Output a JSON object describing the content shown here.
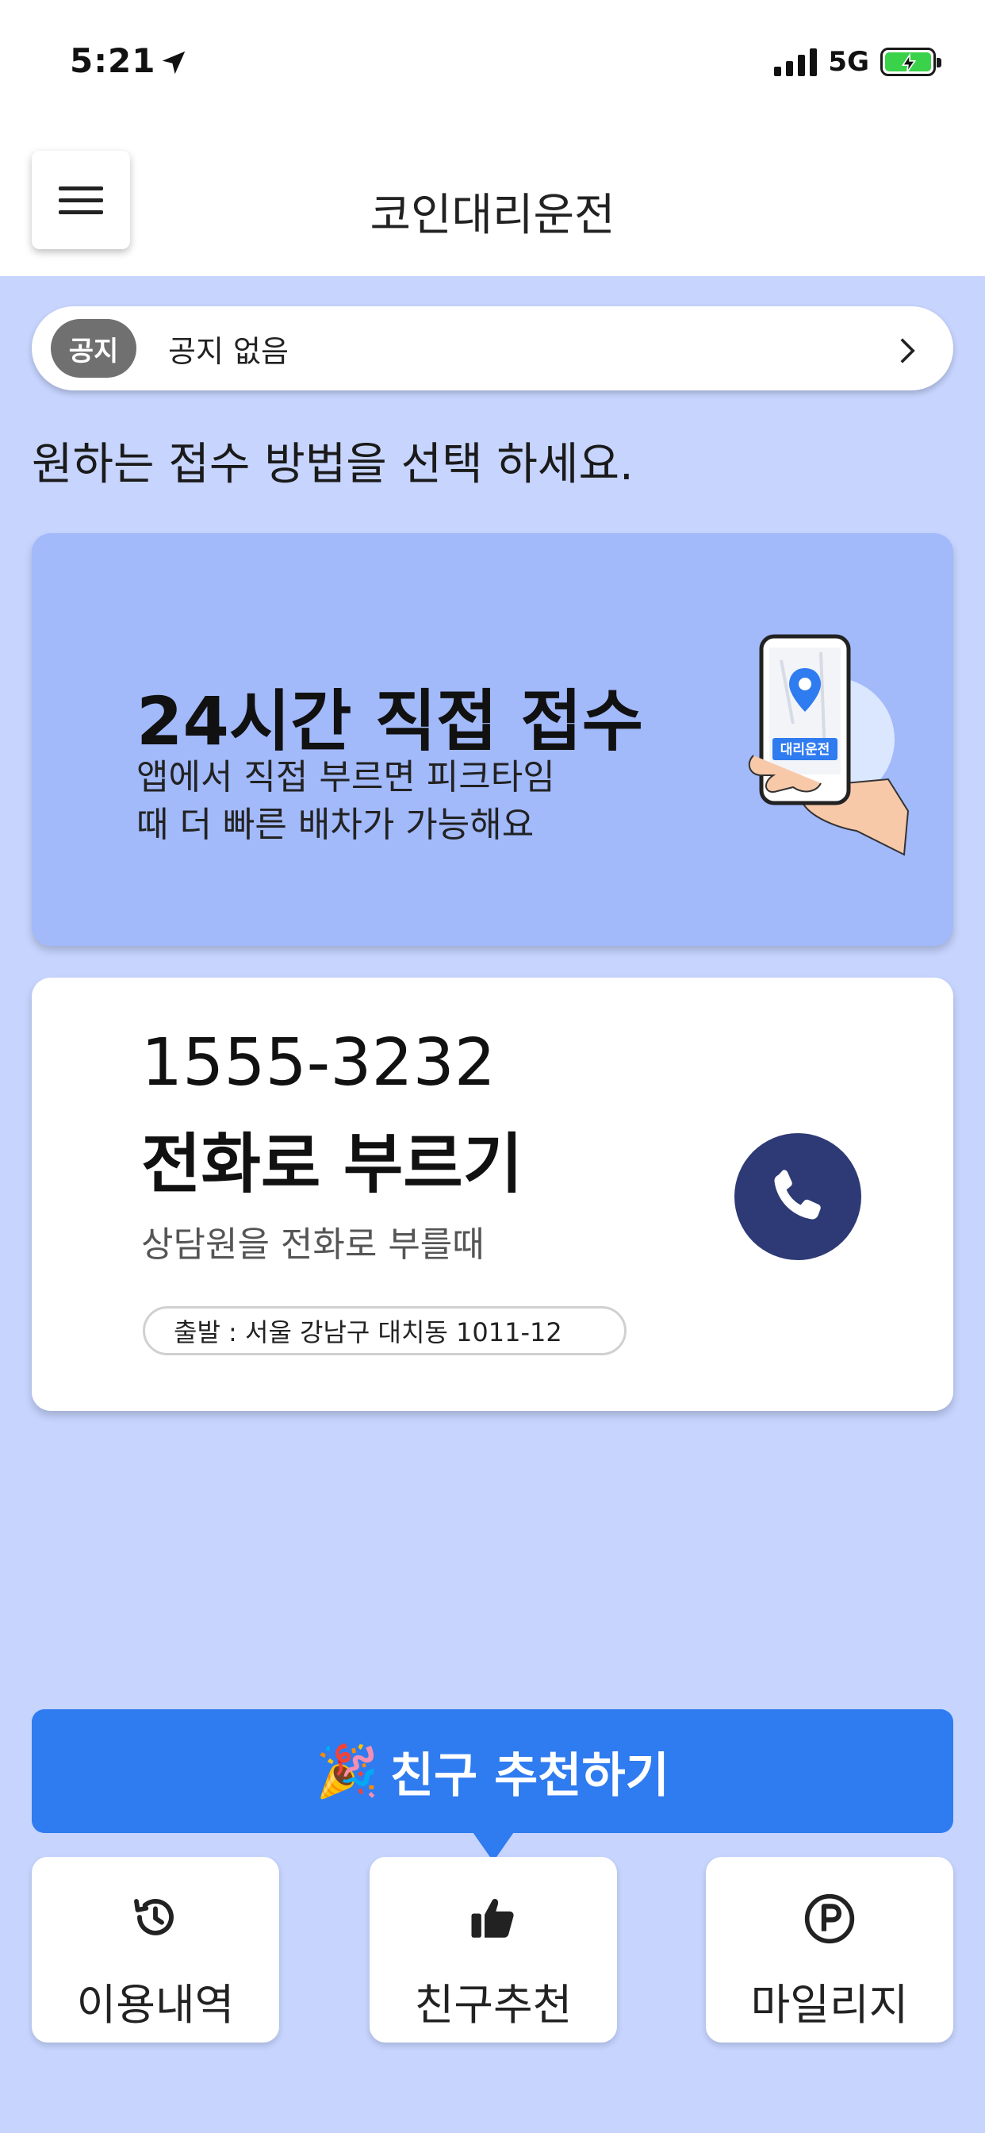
{
  "status_bar": {
    "time": "5:21",
    "network": "5G"
  },
  "header": {
    "title": "코인대리운전"
  },
  "notice": {
    "badge": "공지",
    "text": "공지 없음"
  },
  "prompt": "원하는 접수 방법을 선택 하세요.",
  "direct_card": {
    "title": "24시간 직접 접수",
    "description": "앱에서 직접 부르면 피크타임\n때 더 빠른 배차가 가능해요",
    "illustration_label": "대리운전"
  },
  "phone_card": {
    "number": "1555-3232",
    "title": "전화로 부르기",
    "description": "상담원을 전화로 부를때",
    "origin": "출발 : 서울 강남구 대치동 1011-12"
  },
  "referral_banner": {
    "label": "친구 추천하기",
    "emoji": "🎉"
  },
  "bottom_tabs": [
    {
      "label": "이용내역",
      "icon": "history-icon"
    },
    {
      "label": "친구추천",
      "icon": "thumbs-up-icon"
    },
    {
      "label": "마일리지",
      "icon": "parking-p-icon"
    }
  ],
  "colors": {
    "background": "#c6d4fe",
    "direct_card": "#a2b9fa",
    "call_button": "#2e3a75",
    "referral_banner": "#2f7bf0",
    "battery": "#3ad24a"
  }
}
